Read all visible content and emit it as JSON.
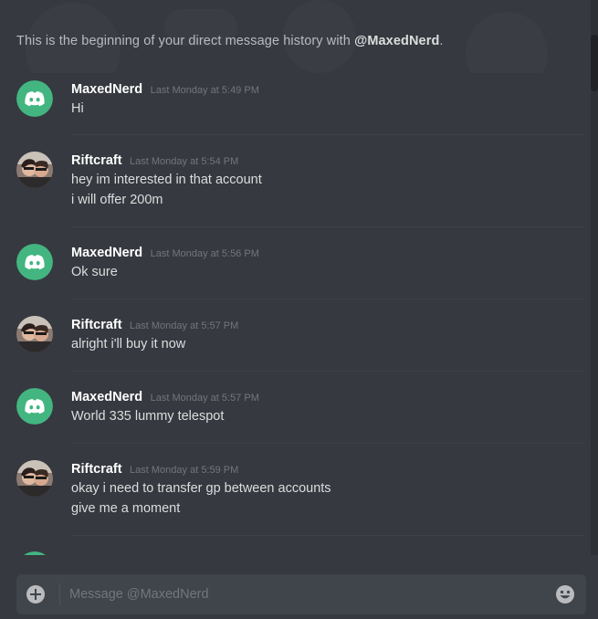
{
  "beginning": {
    "prefix": "This is the beginning of your direct message history with ",
    "mention": "@MaxedNerd",
    "suffix": "."
  },
  "messages": [
    {
      "author": "MaxedNerd",
      "timestamp": "Last Monday at 5:49 PM",
      "avatar": "discord-logo-icon",
      "lines": [
        "Hi"
      ]
    },
    {
      "author": "Riftcraft",
      "timestamp": "Last Monday at 5:54 PM",
      "avatar": "user-photo",
      "lines": [
        "hey im interested in that account",
        "i will offer 200m"
      ]
    },
    {
      "author": "MaxedNerd",
      "timestamp": "Last Monday at 5:56 PM",
      "avatar": "discord-logo-icon",
      "lines": [
        "Ok sure"
      ]
    },
    {
      "author": "Riftcraft",
      "timestamp": "Last Monday at 5:57 PM",
      "avatar": "user-photo",
      "lines": [
        "alright i'll buy it now"
      ]
    },
    {
      "author": "MaxedNerd",
      "timestamp": "Last Monday at 5:57 PM",
      "avatar": "discord-logo-icon",
      "lines": [
        "World 335 lummy telespot"
      ]
    },
    {
      "author": "Riftcraft",
      "timestamp": "Last Monday at 5:59 PM",
      "avatar": "user-photo",
      "lines": [
        "okay i need to transfer gp between accounts",
        "give me a moment"
      ]
    }
  ],
  "composer": {
    "placeholder": "Message @MaxedNerd",
    "value": ""
  },
  "colors": {
    "background": "#36393f",
    "composer_bg": "#40444b",
    "discord_green": "#43b581",
    "username": "#ffffff",
    "timestamp": "#72767d"
  },
  "icons": {
    "attach": "plus-circle-icon",
    "emoji": "smiley-face-icon"
  }
}
